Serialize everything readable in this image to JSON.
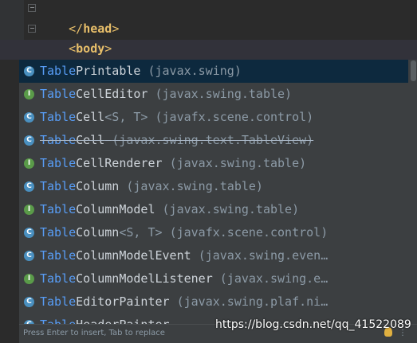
{
  "editor": {
    "head_line": {
      "open": "</",
      "name": "head",
      "close": ">"
    },
    "body_line": {
      "open": "<",
      "name": "body",
      "close": ">"
    },
    "typed_text": "table"
  },
  "completion": {
    "items": [
      {
        "kind": "C",
        "match": "Table",
        "rest": "Printable",
        "generics": "",
        "pkg": "(javax.swing)",
        "deprecated": false,
        "selected": true
      },
      {
        "kind": "I",
        "match": "Table",
        "rest": "CellEditor",
        "generics": "",
        "pkg": "(javax.swing.table)",
        "deprecated": false
      },
      {
        "kind": "C",
        "match": "Table",
        "rest": "Cell",
        "generics": "<S, T>",
        "pkg": "(javafx.scene.control)",
        "deprecated": false
      },
      {
        "kind": "C",
        "match": "Table",
        "rest": "Cell",
        "generics": "",
        "pkg": "(javax.swing.text.TableView)",
        "deprecated": true
      },
      {
        "kind": "I",
        "match": "Table",
        "rest": "CellRenderer",
        "generics": "",
        "pkg": "(javax.swing.table)",
        "deprecated": false
      },
      {
        "kind": "C",
        "match": "Table",
        "rest": "Column",
        "generics": "",
        "pkg": "(javax.swing.table)",
        "deprecated": false
      },
      {
        "kind": "I",
        "match": "Table",
        "rest": "ColumnModel",
        "generics": "",
        "pkg": "(javax.swing.table)",
        "deprecated": false
      },
      {
        "kind": "C",
        "match": "Table",
        "rest": "Column",
        "generics": "<S, T>",
        "pkg": "(javafx.scene.control)",
        "deprecated": false
      },
      {
        "kind": "C",
        "match": "Table",
        "rest": "ColumnModelEvent",
        "generics": "",
        "pkg": "(javax.swing.even…",
        "deprecated": false
      },
      {
        "kind": "I",
        "match": "Table",
        "rest": "ColumnModelListener",
        "generics": "",
        "pkg": "(javax.swing.e…",
        "deprecated": false
      },
      {
        "kind": "C",
        "match": "Table",
        "rest": "EditorPainter",
        "generics": "",
        "pkg": "(javax.swing.plaf.ni…",
        "deprecated": false
      },
      {
        "kind": "C",
        "match": "Table",
        "rest": "HeaderPainter",
        "generics": "",
        "pkg": "",
        "deprecated": false
      }
    ]
  },
  "status_bar": {
    "hint": "Press Enter to insert, Tab to replace",
    "more": "⋮"
  },
  "watermark": "https://blog.csdn.net/qq_41522089"
}
